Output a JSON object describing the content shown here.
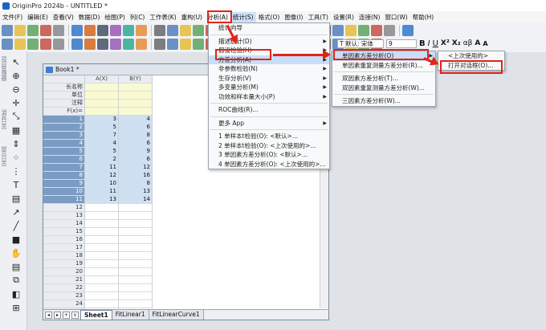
{
  "app_title": "OriginPro 2024b - UNTITLED *",
  "menubar": [
    "文件(F)",
    "编辑(E)",
    "查看(V)",
    "数据(D)",
    "绘图(P)",
    "列(C)",
    "工作表(K)",
    "重构(U)",
    "分析(A)",
    "统计(S)",
    "格式(O)",
    "图像(I)",
    "工具(T)",
    "设置(R)",
    "连接(N)",
    "窗口(W)",
    "帮助(H)"
  ],
  "active_menu": "统计(S)",
  "format_toolbar": {
    "font_prefix": "T 默认: 宋体",
    "font_size": "9",
    "bold": "B",
    "italic": "I",
    "underline": "U"
  },
  "left_panel_labels": [
    "项目管理器",
    "消息日志",
    "提示日志"
  ],
  "workbook": {
    "title": "Book1 *",
    "columns": [
      "A(X)",
      "B(Y)"
    ],
    "meta_rows": [
      "长名称",
      "单位",
      "注释",
      "F(x)="
    ],
    "rows": [
      {
        "n": "1",
        "a": "3",
        "b": "4"
      },
      {
        "n": "2",
        "a": "5",
        "b": "6"
      },
      {
        "n": "3",
        "a": "7",
        "b": "8"
      },
      {
        "n": "4",
        "a": "4",
        "b": "6"
      },
      {
        "n": "5",
        "a": "5",
        "b": "9"
      },
      {
        "n": "6",
        "a": "2",
        "b": "6"
      },
      {
        "n": "7",
        "a": "11",
        "b": "12"
      },
      {
        "n": "8",
        "a": "12",
        "b": "16"
      },
      {
        "n": "9",
        "a": "10",
        "b": "8"
      },
      {
        "n": "10",
        "a": "11",
        "b": "13"
      },
      {
        "n": "11",
        "a": "13",
        "b": "14"
      },
      {
        "n": "12",
        "a": "",
        "b": ""
      },
      {
        "n": "13",
        "a": "",
        "b": ""
      },
      {
        "n": "14",
        "a": "",
        "b": ""
      },
      {
        "n": "15",
        "a": "",
        "b": ""
      },
      {
        "n": "16",
        "a": "",
        "b": ""
      },
      {
        "n": "17",
        "a": "",
        "b": ""
      },
      {
        "n": "18",
        "a": "",
        "b": ""
      },
      {
        "n": "19",
        "a": "",
        "b": ""
      },
      {
        "n": "20",
        "a": "",
        "b": ""
      },
      {
        "n": "21",
        "a": "",
        "b": ""
      },
      {
        "n": "22",
        "a": "",
        "b": ""
      },
      {
        "n": "23",
        "a": "",
        "b": ""
      },
      {
        "n": "24",
        "a": "",
        "b": ""
      },
      {
        "n": "25",
        "a": "",
        "b": ""
      }
    ],
    "sheet_tabs": [
      "Sheet1",
      "FitLinear1",
      "FitLinearCurve1"
    ]
  },
  "stats_menu": {
    "items": [
      {
        "label": "统计向导",
        "submenu": false
      },
      {
        "sep": true
      },
      {
        "label": "描述统计(D)",
        "submenu": true
      },
      {
        "label": "假设检验(H)",
        "submenu": true
      },
      {
        "label": "方差分析(A)",
        "submenu": true,
        "highlight": true
      },
      {
        "label": "非参数检验(N)",
        "submenu": true
      },
      {
        "label": "生存分析(V)",
        "submenu": true
      },
      {
        "label": "多变量分析(M)",
        "submenu": true
      },
      {
        "label": "功效和样本量大小(P)",
        "submenu": true
      },
      {
        "sep": true
      },
      {
        "label": "ROC曲线(R)...",
        "submenu": false
      },
      {
        "sep": true
      },
      {
        "label": "更多 App",
        "submenu": true
      },
      {
        "sep": true
      },
      {
        "label": "1 单样本t检验(O): <默认>...",
        "submenu": false
      },
      {
        "label": "2 单样本t检验(O): <上次使用的>...",
        "submenu": false
      },
      {
        "label": "3 单因素方差分析(O): <默认>...",
        "submenu": false
      },
      {
        "label": "4 单因素方差分析(O): <上次使用的>...",
        "submenu": false
      }
    ]
  },
  "anova_menu": {
    "items": [
      {
        "label": "单因素方差分析(O)",
        "submenu": true,
        "highlight": true
      },
      {
        "label": "单因素重复测量方差分析(R)...",
        "submenu": false
      },
      {
        "sep": true
      },
      {
        "label": "双因素方差分析(T)...",
        "submenu": false
      },
      {
        "label": "双因素重复测量方差分析(W)...",
        "submenu": false
      },
      {
        "sep": true
      },
      {
        "label": "三因素方差分析(W)...",
        "submenu": false
      }
    ]
  },
  "oneway_menu": {
    "items": [
      {
        "label": "<上次使用的>"
      },
      {
        "label": "打开对话框(O)..."
      }
    ]
  },
  "colors": {
    "highlight_red": "#e2231a",
    "selection": "#c8def6",
    "header_blue": "#7a9cc3"
  }
}
